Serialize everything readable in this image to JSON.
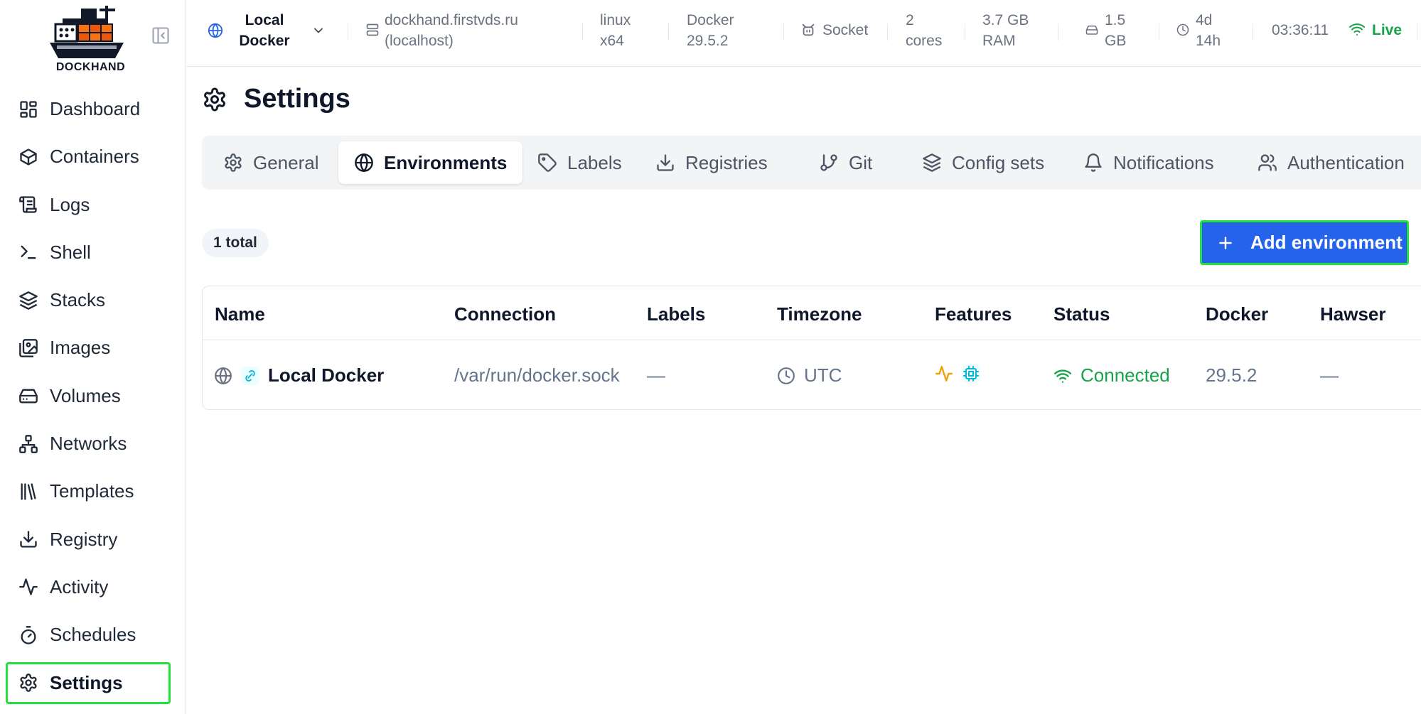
{
  "sidebar": {
    "logo_text": "DOCKHAND",
    "items": [
      {
        "label": "Dashboard",
        "icon": "dashboard-icon"
      },
      {
        "label": "Containers",
        "icon": "box-icon"
      },
      {
        "label": "Logs",
        "icon": "scroll-icon"
      },
      {
        "label": "Shell",
        "icon": "terminal-icon"
      },
      {
        "label": "Stacks",
        "icon": "layers-icon"
      },
      {
        "label": "Images",
        "icon": "images-icon"
      },
      {
        "label": "Volumes",
        "icon": "hard-drive-icon"
      },
      {
        "label": "Networks",
        "icon": "network-icon"
      },
      {
        "label": "Templates",
        "icon": "library-icon"
      },
      {
        "label": "Registry",
        "icon": "download-icon"
      },
      {
        "label": "Activity",
        "icon": "activity-icon"
      },
      {
        "label": "Schedules",
        "icon": "timer-icon"
      },
      {
        "label": "Settings",
        "icon": "gear-icon",
        "active": true
      }
    ]
  },
  "header": {
    "env_line1": "Local",
    "env_line2": "Docker",
    "host_line1": "dockhand.firstvds.ru",
    "host_line2": "(localhost)",
    "os_line1": "linux",
    "os_line2": "x64",
    "docker_line1": "Docker",
    "docker_line2": "29.5.2",
    "conn": "Socket",
    "cpu_line1": "2",
    "cpu_line2": "cores",
    "ram_line1": "3.7 GB",
    "ram_line2": "RAM",
    "disk_line1": "1.5",
    "disk_line2": "GB",
    "uptime_line1": "4d",
    "uptime_line2": "14h",
    "time": "03:36:11",
    "live": "Live"
  },
  "page": {
    "title": "Settings"
  },
  "tabs": [
    {
      "label": "General",
      "icon": "gear-icon"
    },
    {
      "label": "Environments",
      "icon": "globe-icon",
      "active": true
    },
    {
      "label": "Labels",
      "icon": "tag-icon"
    },
    {
      "label": "Registries",
      "icon": "download-icon"
    },
    {
      "label": "Git",
      "icon": "git-branch-icon"
    },
    {
      "label": "Config sets",
      "icon": "layers-icon"
    },
    {
      "label": "Notifications",
      "icon": "bell-icon"
    },
    {
      "label": "Authentication",
      "icon": "users-icon"
    }
  ],
  "environments": {
    "total": "1 total",
    "add_label": "Add environment",
    "columns": [
      "Name",
      "Connection",
      "Labels",
      "Timezone",
      "Features",
      "Status",
      "Docker",
      "Hawser"
    ],
    "rows": [
      {
        "name": "Local Docker",
        "connection": "/var/run/docker.sock",
        "labels": "—",
        "timezone": "UTC",
        "status": "Connected",
        "docker": "29.5.2",
        "hawser": "—"
      }
    ]
  },
  "colors": {
    "accent": "#2563eb",
    "highlight": "#22e33b",
    "success": "#16a34a",
    "feature_activity": "#f59e0b",
    "feature_cpu": "#06b6d4"
  }
}
